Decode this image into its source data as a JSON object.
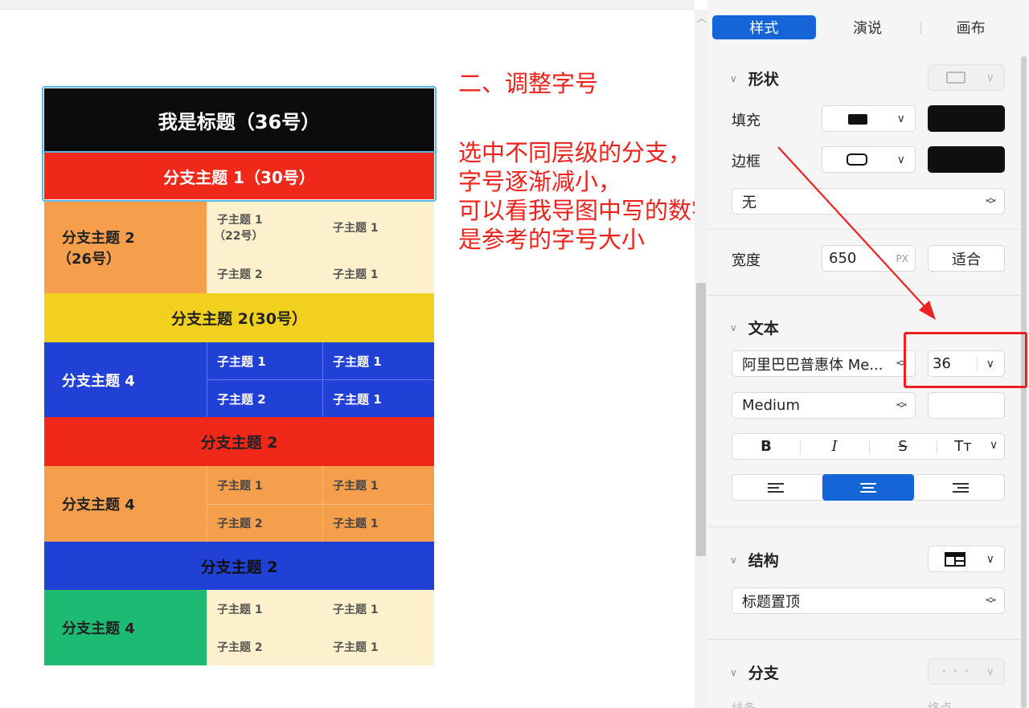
{
  "map": {
    "title": "我是标题（36号）",
    "branch1": "分支主题 1（30号）",
    "group1": {
      "main_line1": "分支主题 2",
      "main_line2": "（26号）",
      "c11_line1": "子主题 1",
      "c11_line2": "（22号）",
      "c12": "子主题 1",
      "c21": "子主题 2",
      "c22": "子主题 1"
    },
    "band2": "分支主题 2(30号）",
    "group2": {
      "main": "分支主题 4",
      "c11": "子主题 1",
      "c12": "子主题 1",
      "c21": "子主题 2",
      "c22": "子主题 1"
    },
    "band3": "分支主题 2",
    "group3": {
      "main": "分支主题 4",
      "c11": "子主题 1",
      "c12": "子主题 1",
      "c21": "子主题 2",
      "c22": "子主题 1"
    },
    "band4": "分支主题 2",
    "group4": {
      "main": "分支主题 4",
      "c11": "子主题 1",
      "c12": "子主题 1",
      "c21": "子主题 2",
      "c22": "子主题 1"
    }
  },
  "annotation": {
    "title": "二、调整字号",
    "lines": [
      "选中不同层级的分支，",
      "字号逐渐减小，",
      "可以看我导图中写的数字，",
      "是参考的字号大小"
    ]
  },
  "panel": {
    "tabs": [
      {
        "label": "样式",
        "active": true
      },
      {
        "label": "演说"
      },
      {
        "label": "画布"
      }
    ],
    "shape": {
      "title": "形状",
      "fill_label": "填充",
      "border_label": "边框",
      "border_style": "无",
      "width_label": "宽度",
      "width_value": "650",
      "width_unit": "PX",
      "fit_label": "适合"
    },
    "text": {
      "title": "文本",
      "font": "阿里巴巴普惠体 Me...",
      "size": "36",
      "weight": "Medium",
      "bold": "B",
      "italic": "I",
      "strike": "S",
      "case": "Tт"
    },
    "structure": {
      "title": "结构",
      "layout": "标题置顶"
    },
    "branch": {
      "title": "分支",
      "dots": "• • •",
      "line_label": "线条",
      "end_label": "终点"
    }
  },
  "colors": {
    "accent": "#1565d8",
    "title_bg": "#0c0c0c",
    "red": "#f0281a",
    "orange": "#f59e4c",
    "cream": "#fdf0cc",
    "yellow": "#f2d11e",
    "blue": "#2140d6",
    "green": "#1cba73",
    "annotation": "#f0201b"
  },
  "icons": [
    "rect-shape-icon",
    "fill-swatch-icon",
    "border-rounded-icon",
    "align-left-icon",
    "align-center-icon",
    "align-right-icon",
    "structure-icon",
    "chevron-down-icon",
    "updown-icon"
  ]
}
